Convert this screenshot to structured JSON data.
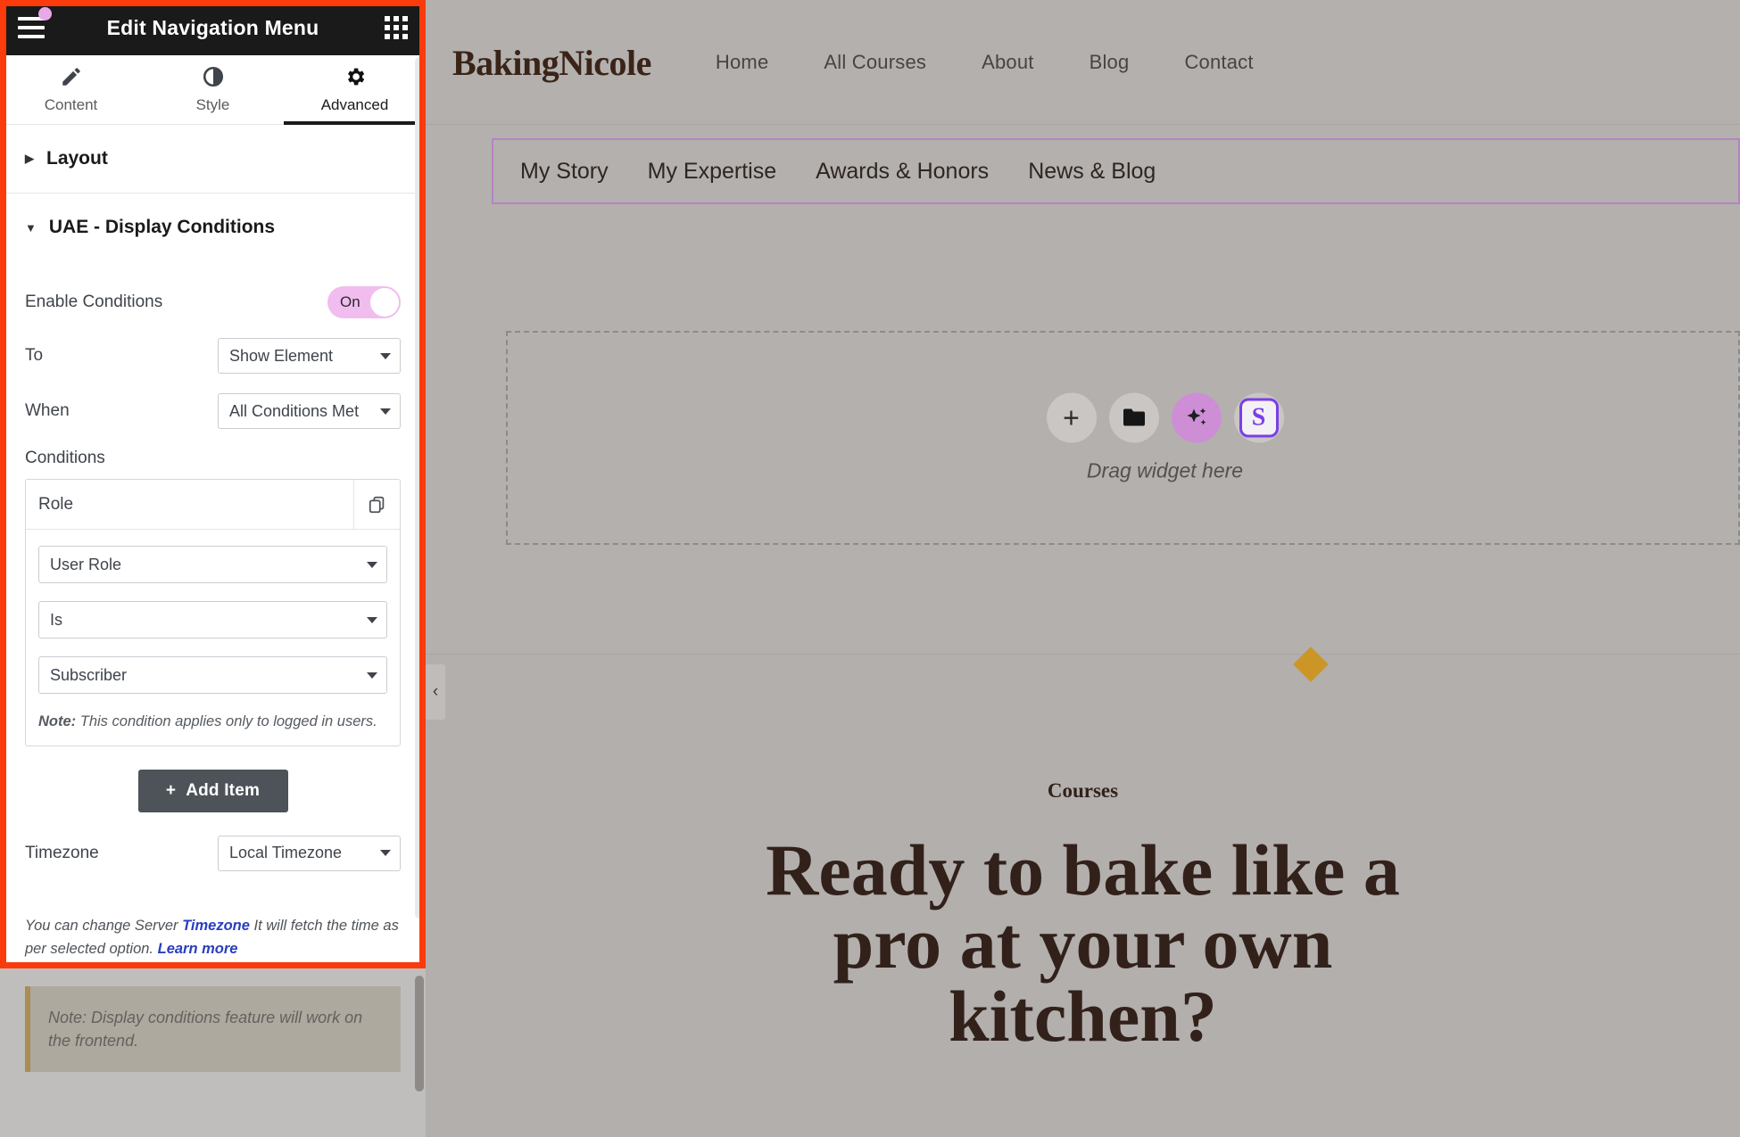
{
  "panel": {
    "header": {
      "title": "Edit Navigation Menu",
      "menu_icon": "hamburger-icon",
      "grid_icon": "apps-grid-icon"
    },
    "tabs": [
      {
        "label": "Content",
        "icon": "pencil-icon",
        "active": false
      },
      {
        "label": "Style",
        "icon": "half-circle-icon",
        "active": false
      },
      {
        "label": "Advanced",
        "icon": "gear-icon",
        "active": true
      }
    ],
    "sections": [
      {
        "label": "Layout",
        "expanded": false
      },
      {
        "label": "UAE - Display Conditions",
        "expanded": true
      }
    ],
    "display_conditions": {
      "enable_label": "Enable Conditions",
      "enable_value": "On",
      "to_label": "To",
      "to_value": "Show Element",
      "when_label": "When",
      "when_value": "All Conditions Met",
      "conditions_label": "Conditions",
      "condition_item": {
        "title": "Role",
        "duplicate_icon": "copy-icon",
        "type_value": "User Role",
        "operator_value": "Is",
        "role_value": "Subscriber",
        "note_prefix": "Note:",
        "note_text": " This condition applies only to logged in users."
      },
      "add_item_label": "Add Item",
      "add_item_icon": "plus-icon",
      "timezone_label": "Timezone",
      "timezone_value": "Local Timezone",
      "helper": {
        "part1": "You can change Server ",
        "link1": "Timezone",
        "part2": " It will fetch the time as per selected option. ",
        "link2": "Learn more"
      },
      "callout_text": "Note: Display conditions feature will work on the frontend."
    }
  },
  "preview": {
    "logo": "BakingNicole",
    "nav": [
      "Home",
      "All Courses",
      "About",
      "Blog",
      "Contact"
    ],
    "subnav": [
      "My Story",
      "My Expertise",
      "Awards & Honors",
      "News & Blog"
    ],
    "dropzone": {
      "label": "Drag widget here",
      "buttons": [
        "add-widget-icon",
        "folder-icon",
        "ai-sparkle-icon",
        "s-logo-icon"
      ],
      "s_letter": "S"
    },
    "eyebrow": "Courses",
    "hero_title": "Ready to bake like a pro at your own kitchen?",
    "collapse_icon": "chevron-left-icon"
  },
  "colors": {
    "highlight": "#fb3b0c",
    "accent_purple": "#b782c4",
    "toggle_on": "#f0bdee",
    "gold": "#cc9627",
    "brown": "#32211a",
    "panel_dark": "#1a1a1a"
  }
}
